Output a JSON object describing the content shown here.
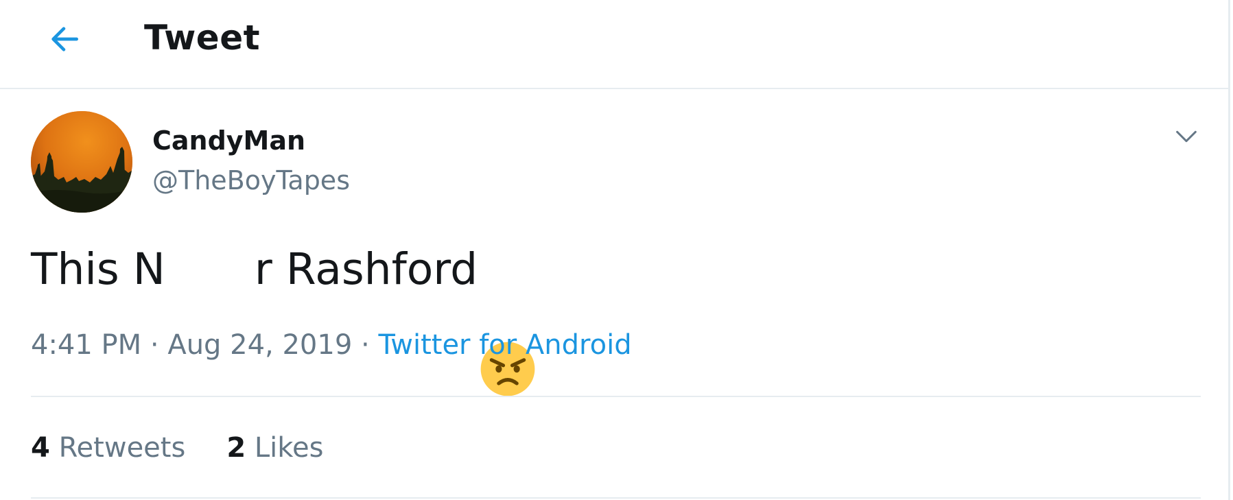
{
  "header": {
    "title": "Tweet",
    "back_icon": "arrow-left-icon"
  },
  "tweet": {
    "author": {
      "display_name": "CandyMan",
      "handle": "@TheBoyTapes"
    },
    "text_before": "This N",
    "text_after": "r Rashford",
    "emoji": "angry-face-emoji",
    "time": "4:41 PM",
    "date": "Aug 24, 2019",
    "source": "Twitter for Android",
    "separator": "·",
    "stats": {
      "retweets_count": "4",
      "retweets_label": "Retweets",
      "likes_count": "2",
      "likes_label": "Likes"
    },
    "caret_icon": "chevron-down-icon"
  },
  "colors": {
    "accent": "#1b95e0",
    "text_primary": "#14171a",
    "text_secondary": "#657786",
    "border": "#e6ecf0",
    "avatar_orange": "#e07514"
  }
}
